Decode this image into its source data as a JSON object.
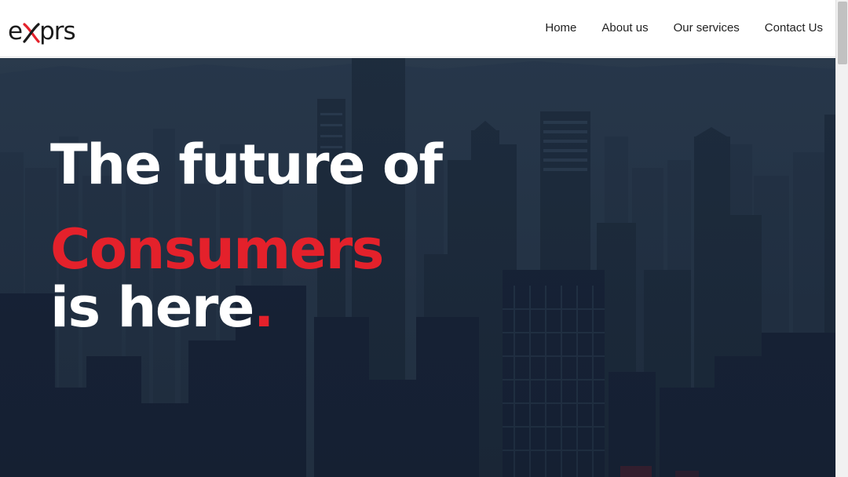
{
  "brand": {
    "logo_text_left": "e",
    "logo_text_right": "prs",
    "logo_accent_color": "#e4212b"
  },
  "nav": {
    "items": [
      {
        "label": "Home"
      },
      {
        "label": "About us"
      },
      {
        "label": "Our services"
      },
      {
        "label": "Contact Us"
      }
    ]
  },
  "hero": {
    "line1": "The future of",
    "line2": "Consumers",
    "line3": "is here",
    "line3_dot": ".",
    "accent_color": "#e4212b",
    "background_icon": "city-skyline-image"
  }
}
